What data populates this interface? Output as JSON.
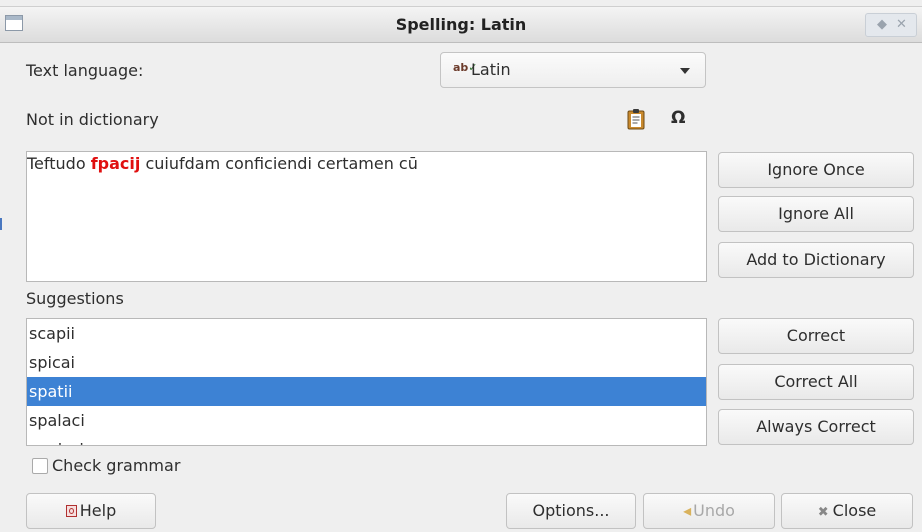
{
  "window": {
    "title": "Spelling: Latin"
  },
  "language": {
    "label": "Text language:",
    "selected": "Latin",
    "icon": "spellcheck-icon"
  },
  "not_in_dictionary": {
    "label": "Not in dictionary",
    "sentence_before": "Teftudo ",
    "misspelled_word": "fpacij",
    "sentence_after": " cuiufdam conficiendi certamen cū"
  },
  "tools": {
    "paste_icon": "clipboard-icon",
    "special_char_icon": "omega-icon",
    "special_char_glyph": "Ω"
  },
  "side_buttons": {
    "ignore_once": "Ignore Once",
    "ignore_all": "Ignore All",
    "add_to_dictionary": "Add to Dictionary",
    "correct": "Correct",
    "correct_all": "Correct All",
    "always_correct": "Always Correct"
  },
  "suggestions": {
    "label": "Suggestions",
    "items": [
      "scapii",
      "spicai",
      "spatii",
      "spalaci",
      "pacisci"
    ],
    "selected": "spatii"
  },
  "check_grammar": {
    "label": "Check grammar",
    "checked": false
  },
  "footer": {
    "help": "Help",
    "options": "Options...",
    "undo": "Undo",
    "close": "Close"
  },
  "colors": {
    "misspelled": "#e01010",
    "selection": "#3d82d4"
  }
}
